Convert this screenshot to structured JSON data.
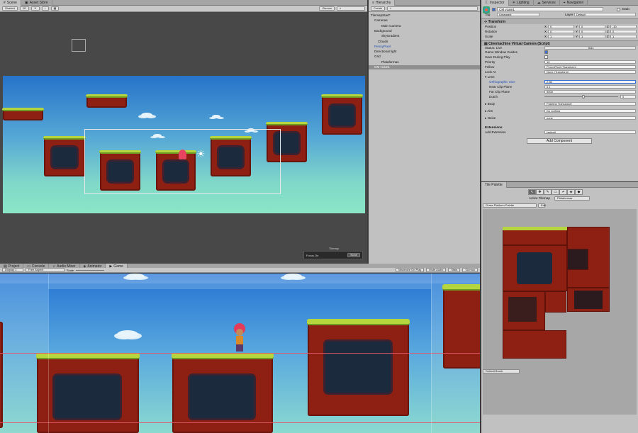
{
  "scene": {
    "tabs": [
      {
        "label": "Scene",
        "icon": "scene-icon"
      },
      {
        "label": "Asset Store",
        "icon": "store-icon"
      }
    ],
    "toolbar": {
      "shading": "Shaded",
      "mode_2d": "2D",
      "gizmos": "Gizmos"
    },
    "tilemap_label": "Tilemap",
    "focus_label": "Focus On",
    "focus_value": "None"
  },
  "hierarchy": {
    "tab": "Hierarchy",
    "create_label": "Create",
    "items": [
      {
        "label": "TilemapStart*",
        "indent": 0,
        "style": "root"
      },
      {
        "label": "Cameras",
        "indent": 1,
        "style": ""
      },
      {
        "label": "Main Camera",
        "indent": 3,
        "style": ""
      },
      {
        "label": "Background",
        "indent": 1,
        "style": ""
      },
      {
        "label": "SkyGradient",
        "indent": 3,
        "style": ""
      },
      {
        "label": "Clouds",
        "indent": 2,
        "style": ""
      },
      {
        "label": "PennyPixel",
        "indent": 1,
        "style": "blue"
      },
      {
        "label": "Directional light",
        "indent": 1,
        "style": ""
      },
      {
        "label": "Grid",
        "indent": 1,
        "style": ""
      },
      {
        "label": "Plataformas",
        "indent": 3,
        "style": ""
      },
      {
        "label": "CM vcam1",
        "indent": 1,
        "style": "sel"
      }
    ]
  },
  "inspector": {
    "tabs": [
      "Inspector",
      "Lighting",
      "Services",
      "Navigation"
    ],
    "object_name": "CM vcam1",
    "static_label": "Static",
    "tag_label": "Tag",
    "tag_value": "Untagged",
    "layer_label": "Layer",
    "layer_value": "Default",
    "transform": {
      "title": "Transform",
      "rows": [
        {
          "label": "Position",
          "x": "0",
          "y": "0",
          "z": "-10"
        },
        {
          "label": "Rotation",
          "x": "0",
          "y": "0",
          "z": "0"
        },
        {
          "label": "Scale",
          "x": "1",
          "y": "1",
          "z": "1"
        }
      ]
    },
    "vcam": {
      "title": "Cinemachine Virtual Camera (Script)",
      "status_label": "Status: Live",
      "solo_label": "Solo",
      "game_window_guides": "Game Window Guides",
      "save_during_play": "Save During Play",
      "priority_label": "Priority",
      "priority_value": "10",
      "follow_label": "Follow",
      "follow_value": "PennyPixel (Transform)",
      "lookat_label": "Look At",
      "lookat_value": "None (Transform)",
      "lens_label": "Lens",
      "ortho_label": "Orthographic Size",
      "ortho_value": "2.56",
      "near_label": "Near Clip Plane",
      "near_value": "0.1",
      "far_label": "Far Clip Plane",
      "far_value": "5000",
      "dutch_label": "Dutch",
      "dutch_value": "0",
      "body_label": "Body",
      "body_value": "Framing Transposer",
      "aim_label": "Aim",
      "aim_value": "Do nothing",
      "noise_label": "Noise",
      "noise_value": "none",
      "extensions_label": "Extensions",
      "add_ext_label": "Add Extension",
      "add_ext_value": "(select)"
    },
    "add_component": "Add Component"
  },
  "palette": {
    "tab": "Tile Palette",
    "active_tilemap_label": "Active Tilemap",
    "active_tilemap_value": "Plataformas",
    "palette_name": "Grass Platform Palette",
    "edit_label": "Edit",
    "brush_label": "Default Brush"
  },
  "game": {
    "tabs": [
      {
        "label": "Project",
        "icon": "project-icon"
      },
      {
        "label": "Console",
        "icon": "console-icon"
      },
      {
        "label": "Audio Mixer",
        "icon": "audio-mixer-icon"
      },
      {
        "label": "Animator",
        "icon": "animator-icon"
      },
      {
        "label": "Game",
        "icon": "game-icon"
      }
    ],
    "display": "Display 1",
    "aspect": "Free Aspect",
    "scale_label": "Scale",
    "maximize": "Maximize On Play",
    "mute": "Mute Audio",
    "stats": "Stats",
    "gizmos": "Gizmos"
  },
  "colors": {
    "grass": "#b6d640",
    "rock": "#8d1f13",
    "selection": "#8f8f8f"
  }
}
